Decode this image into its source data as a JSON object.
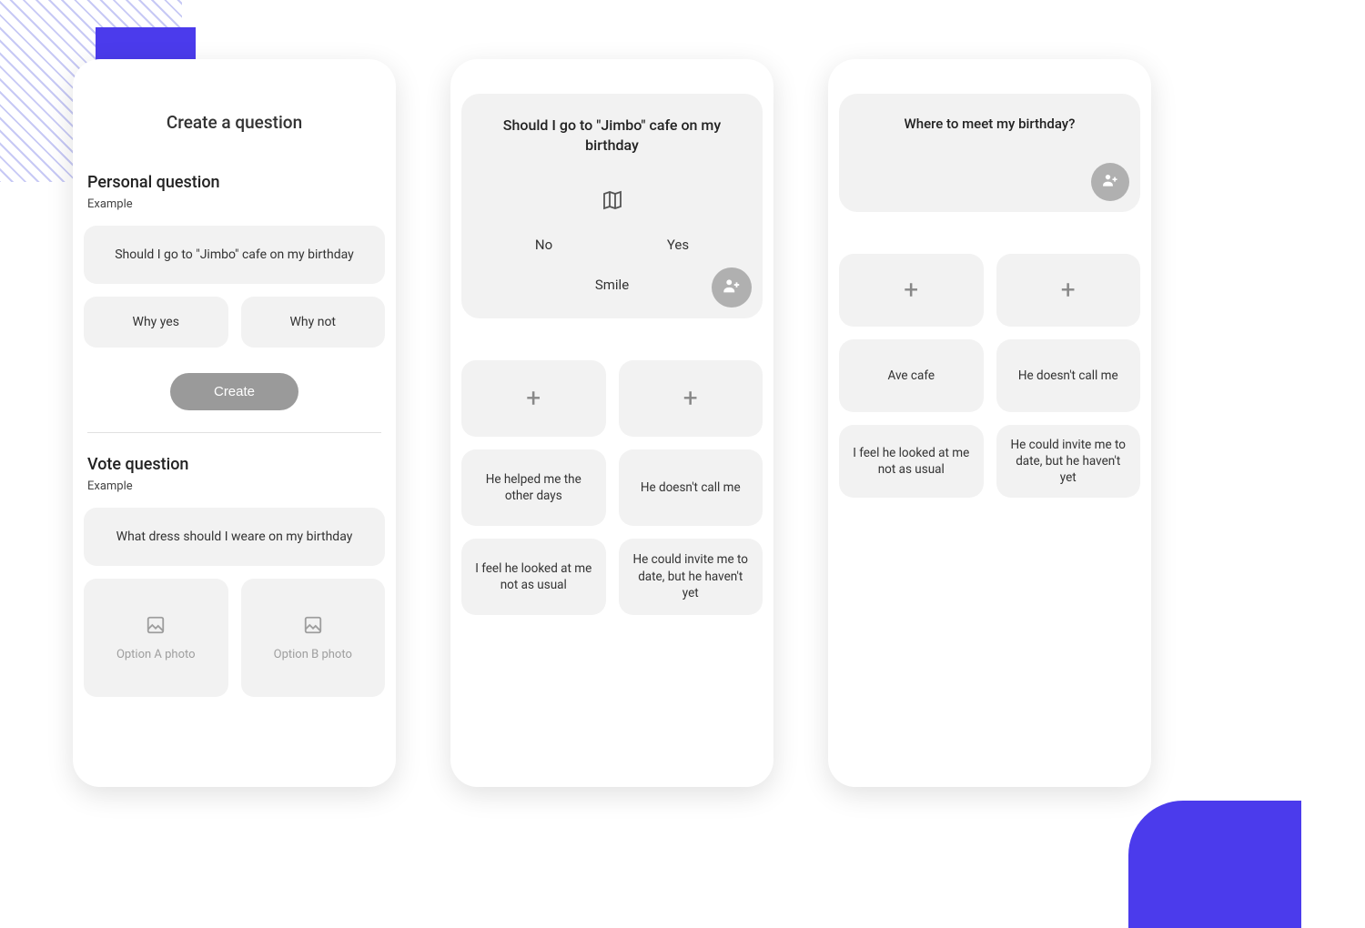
{
  "colors": {
    "accent": "#4b3bec",
    "surface": "#f2f2f2",
    "text": "#333333",
    "muted": "#9e9e9e",
    "buttonBg": "#9a9a9a",
    "avatarBg": "#b0b0b0"
  },
  "screen1": {
    "title": "Create a question",
    "personal": {
      "heading": "Personal question",
      "exampleLabel": "Example",
      "questionText": "Should I go to \"Jimbo\" cafe on my birthday",
      "chipA": "Why yes",
      "chipB": "Why not",
      "createLabel": "Create"
    },
    "vote": {
      "heading": "Vote question",
      "exampleLabel": "Example",
      "questionText": "What dress should I weare on my birthday",
      "photoA": "Option A photo",
      "photoB": "Option B photo"
    }
  },
  "screen2": {
    "question": "Should I go to \"Jimbo\" cafe on my birthday",
    "optionNo": "No",
    "optionYes": "Yes",
    "smile": "Smile",
    "tiles": [
      "He helped me the other days",
      "He doesn't call me",
      "I feel he looked at me not as usual",
      "He could invite me to date, but he haven't yet"
    ]
  },
  "screen3": {
    "question": "Where to meet my birthday?",
    "tiles": [
      "Ave cafe",
      "He doesn't call me",
      "I feel he looked at me not as usual",
      "He could invite me to date, but he haven't yet"
    ]
  }
}
